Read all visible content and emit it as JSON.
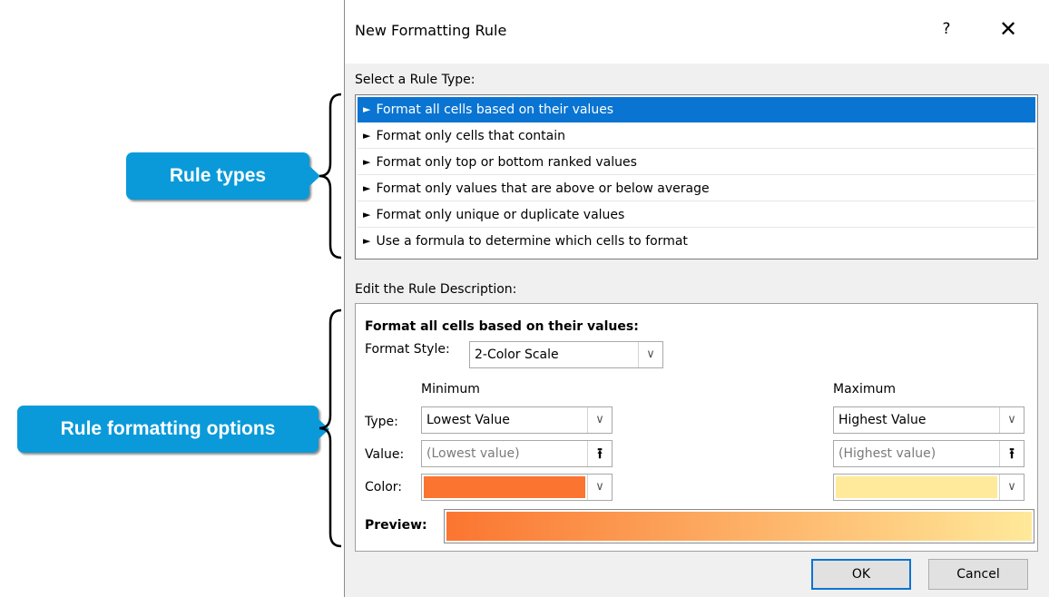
{
  "callouts": {
    "rule_types": "Rule types",
    "rule_formatting_options": "Rule formatting  options"
  },
  "dialog": {
    "title": "New Formatting Rule",
    "help_glyph": "?",
    "close_glyph": "✕",
    "select_rule_type_label": "Select a Rule Type:",
    "rule_types": [
      "Format all cells based on their values",
      "Format only cells that contain",
      "Format only top or bottom ranked values",
      "Format only values that are above or below average",
      "Format only unique or duplicate values",
      "Use a formula to determine which cells to format"
    ],
    "selected_rule_index": 0,
    "edit_description_label": "Edit the Rule Description:",
    "description_heading": "Format all cells based on their values:",
    "format_style_label": "Format Style:",
    "format_style_value": "2-Color Scale",
    "minimum_header": "Minimum",
    "maximum_header": "Maximum",
    "type_label": "Type:",
    "value_label": "Value:",
    "color_label": "Color:",
    "min_type": "Lowest Value",
    "max_type": "Highest Value",
    "min_value_placeholder": "(Lowest value)",
    "max_value_placeholder": "(Highest value)",
    "min_color": "#fb7530",
    "max_color": "#ffe99a",
    "preview_label": "Preview:",
    "ok_label": "OK",
    "cancel_label": "Cancel"
  },
  "colors": {
    "callout_bg": "#0a9ad9",
    "selection": "#0a74d2"
  }
}
